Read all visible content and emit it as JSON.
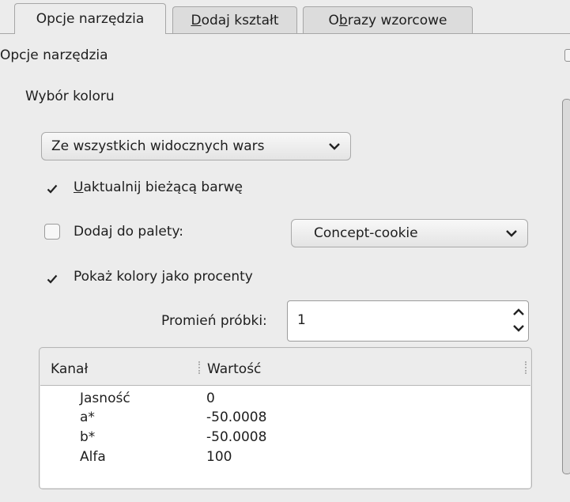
{
  "tabs": [
    {
      "label_pre": "Opcje narzędzia",
      "underline": "",
      "label_post": ""
    },
    {
      "label_pre": "",
      "underline": "D",
      "label_post": "odaj kształt"
    },
    {
      "label_pre": "O",
      "underline": "b",
      "label_post": "razy wzorcowe"
    }
  ],
  "panel": {
    "title_pre": "Opc",
    "title_underline": "j",
    "title_post": "e narzędzia",
    "section": "Wybór koloru"
  },
  "sample_source": {
    "selected": "Ze wszystkich widocznych wars"
  },
  "update_color": {
    "checked": true,
    "underline": "U",
    "label_post": "aktualnij bieżącą barwę"
  },
  "add_to_palette": {
    "checked": false,
    "label": "Dodaj do palety:",
    "palette_selected": "Concept-cookie"
  },
  "show_percent": {
    "checked": true,
    "label": "Pokaż kolory jako procenty"
  },
  "sample_radius": {
    "label": "Promień próbki:",
    "value": "1"
  },
  "channel_table": {
    "headers": [
      "Kanał",
      "Wartość"
    ],
    "rows": [
      {
        "channel": "Jasność",
        "value": "0"
      },
      {
        "channel": "a*",
        "value": "-50.0008"
      },
      {
        "channel": "b*",
        "value": "-50.0008"
      },
      {
        "channel": "Alfa",
        "value": "100"
      }
    ]
  },
  "icons": [
    "chevron-down-icon",
    "check-icon",
    "chevron-up-icon",
    "column-divider-icon"
  ]
}
